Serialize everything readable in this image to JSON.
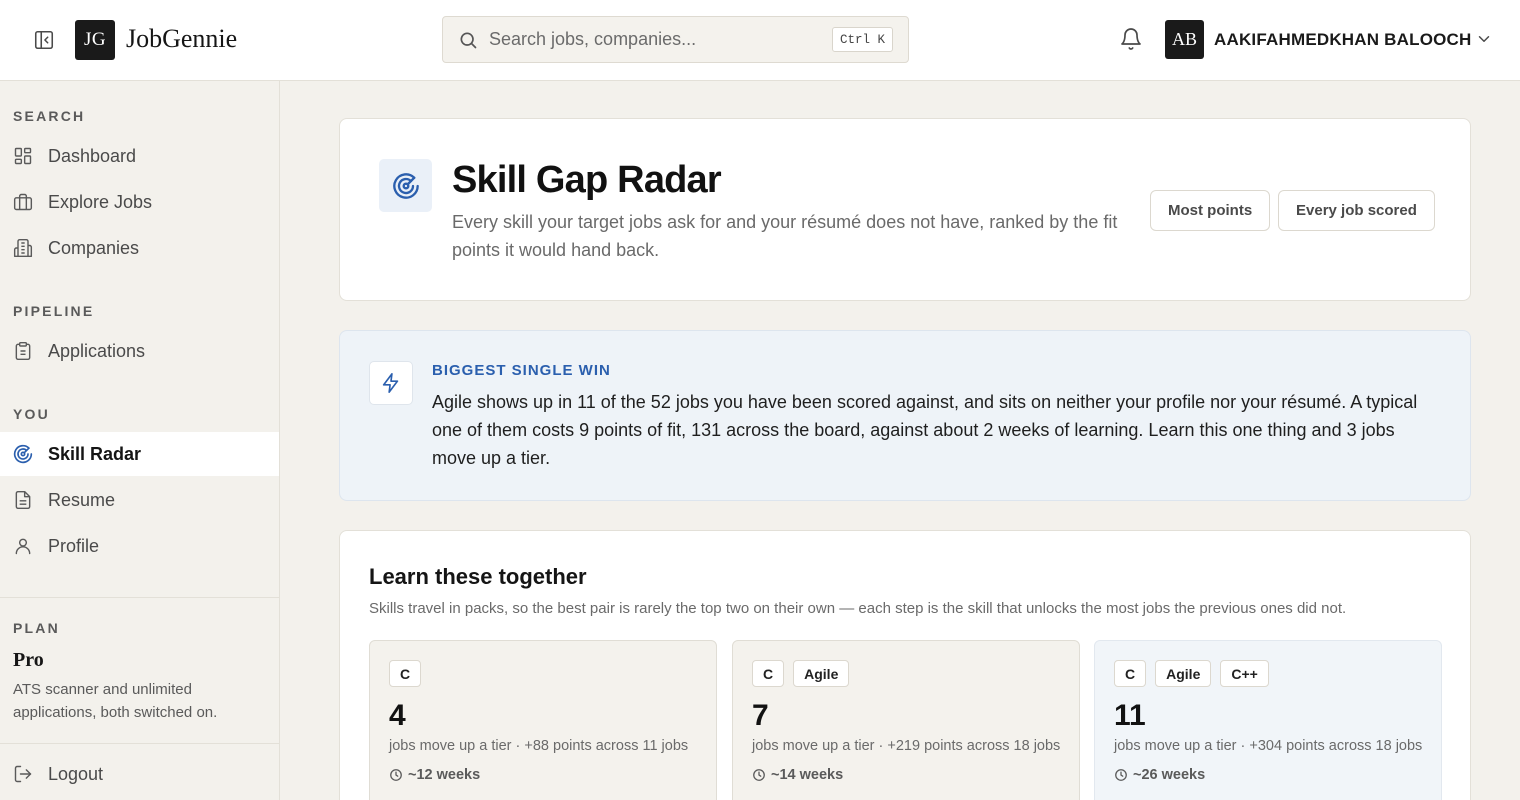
{
  "topbar": {
    "logo_mark": "JG",
    "logo_text": "JobGennie",
    "search_placeholder": "Search jobs, companies...",
    "search_shortcut": "Ctrl K",
    "avatar_initials": "AB",
    "user_name": "AAKIFAHMEDKHAN BALOOCH"
  },
  "sidebar": {
    "sections": {
      "search": "SEARCH",
      "pipeline": "PIPELINE",
      "you": "YOU",
      "plan": "PLAN"
    },
    "items": {
      "dashboard": "Dashboard",
      "explore_jobs": "Explore Jobs",
      "companies": "Companies",
      "applications": "Applications",
      "skill_radar": "Skill Radar",
      "resume": "Resume",
      "profile": "Profile",
      "logout": "Logout"
    },
    "active": "skill_radar",
    "plan_name": "Pro",
    "plan_desc": "ATS scanner and unlimited applications, both switched on."
  },
  "hero": {
    "title": "Skill Gap Radar",
    "subtitle": "Every skill your target jobs ask for and your résumé does not have, ranked by the fit points it would hand back.",
    "sort_most_points": "Most points",
    "sort_every_job": "Every job scored"
  },
  "biggest_win": {
    "label": "BIGGEST SINGLE WIN",
    "text": "Agile shows up in 11 of the 52 jobs you have been scored against, and sits on neither your profile nor your résumé. A typical one of them costs 9 points of fit, 131 across the board, against about 2 weeks of learning. Learn this one thing and 3 jobs move up a tier."
  },
  "learn_together": {
    "title": "Learn these together",
    "subtitle": "Skills travel in packs, so the best pair is rarely the top two on their own — each step is the skill that unlocks the most jobs the previous ones did not.",
    "packs": [
      {
        "skills": [
          "C"
        ],
        "count": "4",
        "desc": "jobs move up a tier · +88 points across 11 jobs",
        "time": "~12 weeks"
      },
      {
        "skills": [
          "C",
          "Agile"
        ],
        "count": "7",
        "desc": "jobs move up a tier · +219 points across 18 jobs",
        "time": "~14 weeks"
      },
      {
        "skills": [
          "C",
          "Agile",
          "C++"
        ],
        "count": "11",
        "desc": "jobs move up a tier · +304 points across 18 jobs",
        "time": "~26 weeks"
      }
    ]
  },
  "colors": {
    "accent_blue": "#2b5fae",
    "background": "#f3f1ec",
    "dark": "#1a1a1a"
  }
}
